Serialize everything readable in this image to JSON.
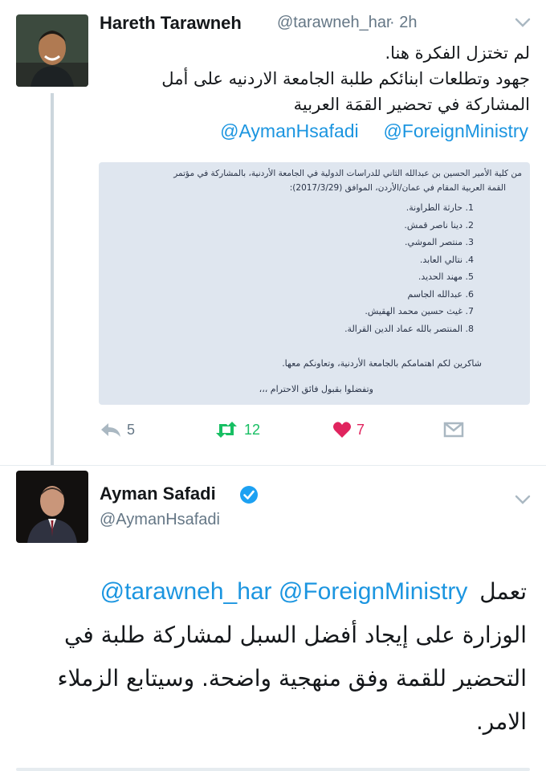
{
  "tweet1": {
    "name": "Hareth Tarawneh",
    "handle": "@tarawneh_har",
    "time": "· 2h",
    "lines": [
      "لم تختزل الفكرة هنا.",
      "جهود وتطلعات ابنائكم طلبة الجامعة الاردنيه على أمل",
      "المشاركة في تحضير القمَة العربية"
    ],
    "mentions": [
      "@AymanHsafadi",
      "@ForeignMinistry"
    ],
    "image": {
      "header1": "من كلية الأمير الحسين بن عبدالله الثاني للدراسات الدولية في الجامعة الأردنية، بالمشاركة في مؤتمر",
      "header2": "القمة العربية المقام في عمان/الأردن، الموافق (2017/3/29):",
      "items": [
        "1. حارثة الطراونة.",
        "2. دينا ناصر قمش.",
        "3. منتصر الموشي.",
        "4. نتالي العابد.",
        "5. مهند الحديد.",
        "6. عبدالله الجاسم",
        "7. غيث حسين محمد الهقيش.",
        "8. المنتصر بالله عماد الدين القرالة."
      ],
      "thanks": "شاكرين لكم اهتمامكم بالجامعة الأردنية، وتعاونكم معها.",
      "closing": "وتفضلوا بقبول فائق الاحترام ،،،"
    },
    "reply_count": "5",
    "retweet_count": "12",
    "like_count": "7"
  },
  "tweet2": {
    "name": "Ayman Safadi",
    "handle": "@AymanHsafadi",
    "verified": true,
    "mention_line": "@tarawneh_har @ForeignMinistry",
    "first_word": "تعمل",
    "lines": [
      "الوزارة على إيجاد أفضل السبل لمشاركة طلبة في",
      "التحضير للقمة وفق منهجية واضحة. وسيتابع الزملاء",
      "الامر."
    ]
  },
  "colors": {
    "accent": "#1b95e0",
    "retweet": "#17bf63",
    "like": "#e0245e",
    "muted": "#657786",
    "doc_bg": "#dfe6ef"
  }
}
